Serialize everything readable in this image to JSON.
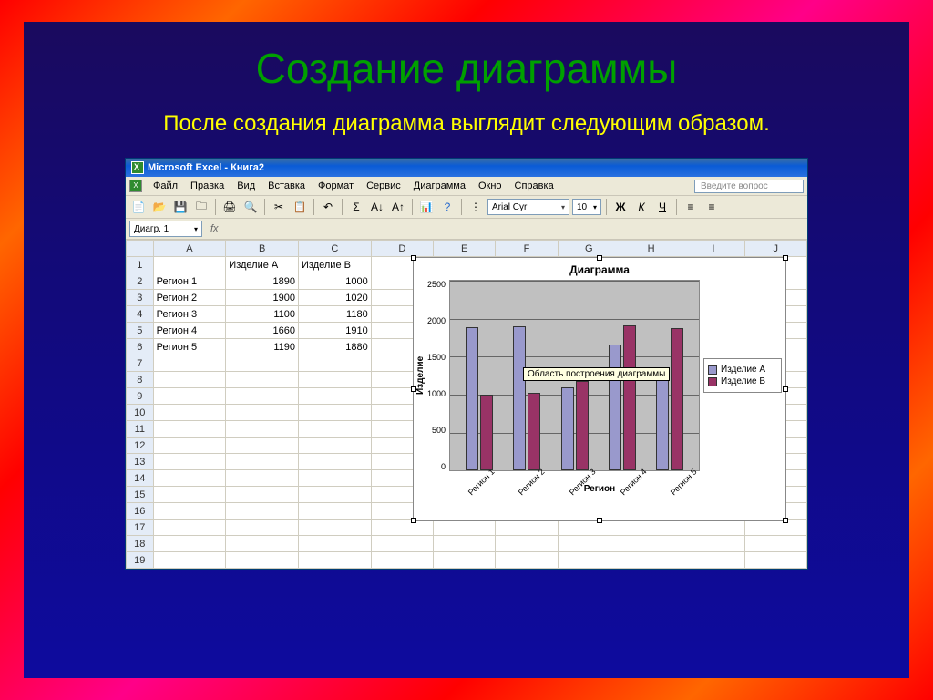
{
  "slide": {
    "title": "Создание диаграммы",
    "subtitle": "После создания диаграмма выглядит следующим образом."
  },
  "excel": {
    "window_title": "Microsoft Excel - Книга2",
    "menus": [
      "Файл",
      "Правка",
      "Вид",
      "Вставка",
      "Формат",
      "Сервис",
      "Диаграмма",
      "Окно",
      "Справка"
    ],
    "help_placeholder": "Введите вопрос",
    "font_name": "Arial Cyr",
    "font_size": "10",
    "bold": "Ж",
    "italic": "К",
    "underline": "Ч",
    "name_box": "Диагр. 1",
    "columns": [
      "A",
      "B",
      "C",
      "D",
      "E",
      "F",
      "G",
      "H",
      "I",
      "J"
    ],
    "row_count": 19,
    "data": {
      "headers": [
        "",
        "Изделие А",
        "Изделие В"
      ],
      "rows": [
        [
          "Регион 1",
          1890,
          1000
        ],
        [
          "Регион 2",
          1900,
          1020
        ],
        [
          "Регион 3",
          1100,
          1180
        ],
        [
          "Регион 4",
          1660,
          1910
        ],
        [
          "Регион 5",
          1190,
          1880
        ]
      ]
    }
  },
  "chart_data": {
    "type": "bar",
    "title": "Диаграмма",
    "xlabel": "Регион",
    "ylabel": "Изделие",
    "categories": [
      "Регион 1",
      "Регион 2",
      "Регион 3",
      "Регион 4",
      "Регион 5"
    ],
    "series": [
      {
        "name": "Изделие А",
        "values": [
          1890,
          1900,
          1100,
          1660,
          1190
        ],
        "color": "#9999cc"
      },
      {
        "name": "Изделие В",
        "values": [
          1000,
          1020,
          1180,
          1910,
          1880
        ],
        "color": "#993366"
      }
    ],
    "ylim": [
      0,
      2500
    ],
    "yticks": [
      0,
      500,
      1000,
      1500,
      2000,
      2500
    ],
    "tooltip": "Область построения диаграммы"
  }
}
